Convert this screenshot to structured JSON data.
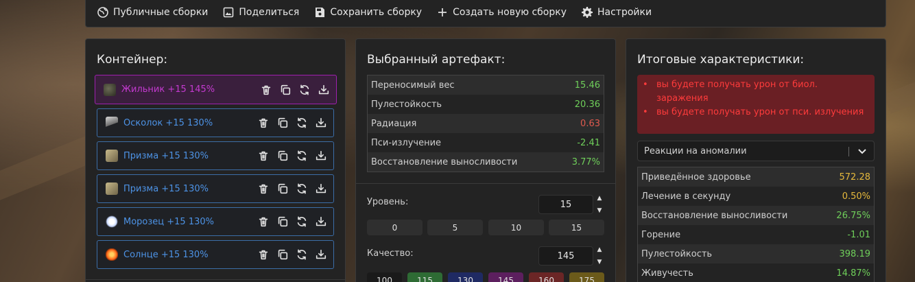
{
  "toolbar": {
    "items": [
      {
        "label": "Публичные сборки",
        "icon": "globe-icon"
      },
      {
        "label": "Поделиться",
        "icon": "image-icon"
      },
      {
        "label": "Сохранить сборку",
        "icon": "save-icon"
      },
      {
        "label": "Создать новую сборку",
        "icon": "plus-icon"
      },
      {
        "label": "Настройки",
        "icon": "gear-icon"
      }
    ]
  },
  "container": {
    "title": "Контейнер:",
    "slots": [
      {
        "label": "Жильник +15 145%",
        "icon": "zhilnik-artifact-icon",
        "color": "#c43ad0"
      },
      {
        "label": "Осколок +15 130%",
        "icon": "oskolok-artifact-icon",
        "color": "#4d93e6"
      },
      {
        "label": "Призма +15 130%",
        "icon": "prizma-artifact-icon",
        "color": "#4d93e6"
      },
      {
        "label": "Призма +15 130%",
        "icon": "prizma-artifact-icon",
        "color": "#4d93e6"
      },
      {
        "label": "Морозец +15 130%",
        "icon": "morozets-artifact-icon",
        "color": "#4d93e6"
      },
      {
        "label": "Солнце +15 130%",
        "icon": "solntse-artifact-icon",
        "color": "#4d93e6"
      }
    ],
    "actions": [
      "trash-icon",
      "copy-icon",
      "refresh-icon",
      "download-icon"
    ]
  },
  "artifact": {
    "title": "Выбранный артефакт:",
    "stats": [
      {
        "name": "Переносимый вес",
        "value": "15.46",
        "tone": "pos"
      },
      {
        "name": "Пулестойкость",
        "value": "20.36",
        "tone": "pos"
      },
      {
        "name": "Радиация",
        "value": "0.63",
        "tone": "neg"
      },
      {
        "name": "Пси-излучение",
        "value": "-2.41",
        "tone": "pos"
      },
      {
        "name": "Восстановление выносливости",
        "value": "3.77%",
        "tone": "pos"
      }
    ],
    "level": {
      "label": "Уровень:",
      "value": "15",
      "presets": [
        "0",
        "5",
        "10",
        "15"
      ]
    },
    "quality": {
      "label": "Качество:",
      "value": "145",
      "presets": [
        {
          "label": "100",
          "color": "#1a1a1a"
        },
        {
          "label": "115",
          "color": "#2e6b34"
        },
        {
          "label": "130",
          "color": "#1f2a63"
        },
        {
          "label": "145",
          "color": "#5c1f5e"
        },
        {
          "label": "160",
          "color": "#6b2626"
        },
        {
          "label": "175",
          "color": "#6b5a1a"
        }
      ]
    }
  },
  "totals": {
    "title": "Итоговые характеристики:",
    "alerts": [
      "вы будете получать урон от биол. заражения",
      "вы будете получать урон от пси. излучения"
    ],
    "select": "Реакции на аномалии",
    "stats": [
      {
        "name": "Приведённое здоровье",
        "value": "572.28",
        "tone": "gold"
      },
      {
        "name": "Лечение в секунду",
        "value": "0.50%",
        "tone": "gold"
      },
      {
        "name": "Восстановление выносливости",
        "value": "26.75%",
        "tone": "pos"
      },
      {
        "name": "Горение",
        "value": "-1.01",
        "tone": "pos"
      },
      {
        "name": "Пулестойкость",
        "value": "398.19",
        "tone": "pos"
      },
      {
        "name": "Живучесть",
        "value": "14.87%",
        "tone": "pos"
      }
    ]
  }
}
